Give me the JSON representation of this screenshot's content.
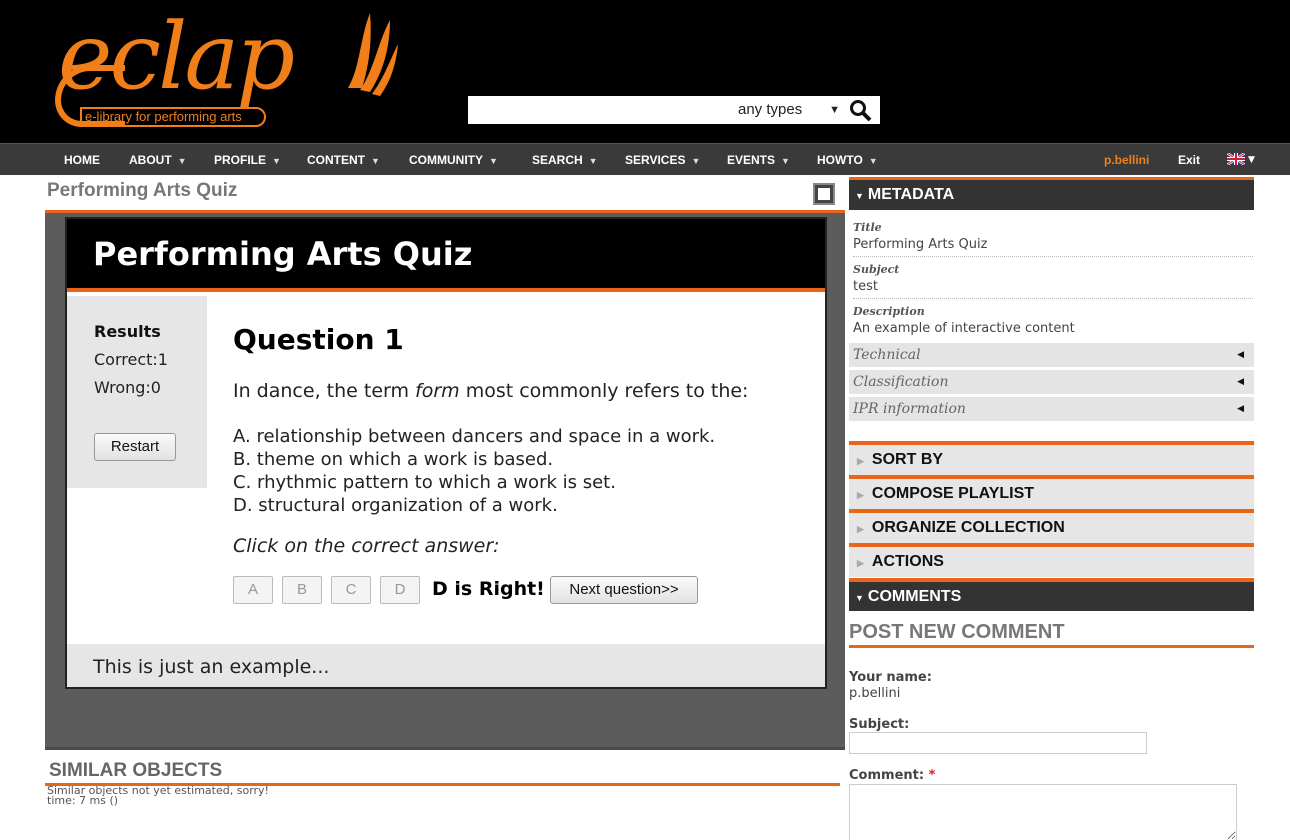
{
  "header": {
    "logo_text": "eclap",
    "logo_tagline": "e-library for performing arts",
    "search_placeholder": "",
    "type_select": "any types"
  },
  "nav": {
    "items": [
      "HOME",
      "ABOUT",
      "PROFILE",
      "CONTENT",
      "COMMUNITY",
      "SEARCH",
      "SERVICES",
      "EVENTS",
      "HOWTO"
    ],
    "user": "p.bellini",
    "exit": "Exit"
  },
  "main": {
    "page_title": "Performing Arts Quiz",
    "quiz": {
      "title": "Performing Arts Quiz",
      "results_title": "Results",
      "correct": "Correct:1",
      "wrong": "Wrong:0",
      "restart": "Restart",
      "question_title": "Question 1",
      "question_pre": "In dance, the term ",
      "question_term": "form",
      "question_post": " most commonly refers to the:",
      "options": [
        "A. relationship between dancers and space in a work.",
        "B. theme on which a work is based.",
        "C. rhythmic pattern to which a work is set.",
        "D. structural organization of a work."
      ],
      "instruction": "Click on the correct answer:",
      "answer_buttons": [
        "A",
        "B",
        "C",
        "D"
      ],
      "feedback": "D is Right!",
      "next": "Next question>>",
      "footer": "This is just an example..."
    },
    "similar": {
      "title": "SIMILAR OBJECTS",
      "note_line1": "Similar objects not yet estimated, sorry!",
      "note_line2": "time: 7 ms ()"
    }
  },
  "sidebar": {
    "metadata_title": "METADATA",
    "fields": [
      {
        "label": "Title",
        "value": "Performing Arts Quiz"
      },
      {
        "label": "Subject",
        "value": "test"
      },
      {
        "label": "Description",
        "value": "An example of interactive content"
      }
    ],
    "collapsed": [
      "Technical",
      "Classification",
      "IPR information"
    ],
    "blocks": [
      "SORT BY",
      "COMPOSE PLAYLIST",
      "ORGANIZE COLLECTION",
      "ACTIONS"
    ],
    "comments_title": "COMMENTS",
    "post_title": "POST NEW COMMENT",
    "your_name_label": "Your name:",
    "your_name_value": "p.bellini",
    "subject_label": "Subject:",
    "comment_label": "Comment:",
    "required_mark": "*"
  },
  "colors": {
    "accent": "#e8651a",
    "logo": "#f07f1a",
    "header_bg": "#000000",
    "nav_bg": "#3a3a3a"
  }
}
